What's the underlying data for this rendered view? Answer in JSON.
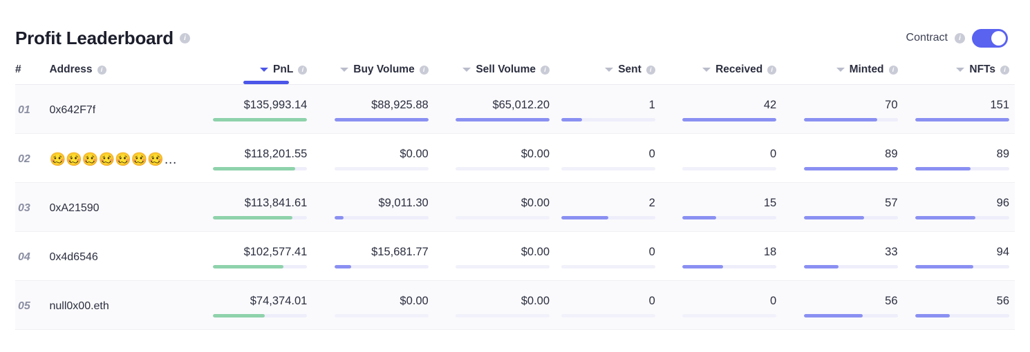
{
  "header": {
    "title": "Profit Leaderboard",
    "title_info_icon": "info-icon",
    "contract_label": "Contract",
    "contract_info_icon": "info-icon",
    "contract_toggle_state": "on"
  },
  "colors": {
    "accent": "#4c56e8",
    "toggle_on": "#5a62f0",
    "bar_purple": "#8a90f2",
    "bar_green": "#8ed2ab",
    "bar_track": "#eeeefb",
    "row_odd_bg": "#fafafc",
    "text": "#2b2e3f",
    "rank_text": "#8b8fa3"
  },
  "table": {
    "columns": [
      {
        "key": "rank",
        "label": "#",
        "align": "left",
        "sortable": false,
        "info": false,
        "sorted": false
      },
      {
        "key": "address",
        "label": "Address",
        "align": "left",
        "sortable": false,
        "info": true,
        "sorted": false
      },
      {
        "key": "pnl",
        "label": "PnL",
        "align": "right",
        "sortable": true,
        "info": true,
        "sorted": true
      },
      {
        "key": "buy",
        "label": "Buy Volume",
        "align": "right",
        "sortable": true,
        "info": true,
        "sorted": false
      },
      {
        "key": "sell",
        "label": "Sell Volume",
        "align": "right",
        "sortable": true,
        "info": true,
        "sorted": false
      },
      {
        "key": "sent",
        "label": "Sent",
        "align": "right",
        "sortable": true,
        "info": true,
        "sorted": false
      },
      {
        "key": "received",
        "label": "Received",
        "align": "right",
        "sortable": true,
        "info": true,
        "sorted": false
      },
      {
        "key": "minted",
        "label": "Minted",
        "align": "right",
        "sortable": true,
        "info": true,
        "sorted": false
      },
      {
        "key": "nfts",
        "label": "NFTs",
        "align": "right",
        "sortable": true,
        "info": true,
        "sorted": false
      }
    ],
    "rows": [
      {
        "rank": "01",
        "address": "0x642F7f",
        "address_is_emoji": false,
        "pnl": {
          "value": "$135,993.14",
          "pct": 100
        },
        "buy": {
          "value": "$88,925.88",
          "pct": 100
        },
        "sell": {
          "value": "$65,012.20",
          "pct": 100
        },
        "sent": {
          "value": "1",
          "pct": 22
        },
        "received": {
          "value": "42",
          "pct": 100
        },
        "minted": {
          "value": "70",
          "pct": 78
        },
        "nfts": {
          "value": "151",
          "pct": 100
        }
      },
      {
        "rank": "02",
        "address": "🥴🥴🥴🥴🥴🥴🥴…",
        "address_is_emoji": true,
        "pnl": {
          "value": "$118,201.55",
          "pct": 87
        },
        "buy": {
          "value": "$0.00",
          "pct": 0
        },
        "sell": {
          "value": "$0.00",
          "pct": 0
        },
        "sent": {
          "value": "0",
          "pct": 0
        },
        "received": {
          "value": "0",
          "pct": 0
        },
        "minted": {
          "value": "89",
          "pct": 100
        },
        "nfts": {
          "value": "89",
          "pct": 59
        }
      },
      {
        "rank": "03",
        "address": "0xA21590",
        "address_is_emoji": false,
        "pnl": {
          "value": "$113,841.61",
          "pct": 84
        },
        "buy": {
          "value": "$9,011.30",
          "pct": 10
        },
        "sell": {
          "value": "$0.00",
          "pct": 0
        },
        "sent": {
          "value": "2",
          "pct": 50
        },
        "received": {
          "value": "15",
          "pct": 36
        },
        "minted": {
          "value": "57",
          "pct": 64
        },
        "nfts": {
          "value": "96",
          "pct": 64
        }
      },
      {
        "rank": "04",
        "address": "0x4d6546",
        "address_is_emoji": false,
        "pnl": {
          "value": "$102,577.41",
          "pct": 75
        },
        "buy": {
          "value": "$15,681.77",
          "pct": 18
        },
        "sell": {
          "value": "$0.00",
          "pct": 0
        },
        "sent": {
          "value": "0",
          "pct": 0
        },
        "received": {
          "value": "18",
          "pct": 43
        },
        "minted": {
          "value": "33",
          "pct": 37
        },
        "nfts": {
          "value": "94",
          "pct": 62
        }
      },
      {
        "rank": "05",
        "address": "null0x00.eth",
        "address_is_emoji": false,
        "pnl": {
          "value": "$74,374.01",
          "pct": 55
        },
        "buy": {
          "value": "$0.00",
          "pct": 0
        },
        "sell": {
          "value": "$0.00",
          "pct": 0
        },
        "sent": {
          "value": "0",
          "pct": 0
        },
        "received": {
          "value": "0",
          "pct": 0
        },
        "minted": {
          "value": "56",
          "pct": 63
        },
        "nfts": {
          "value": "56",
          "pct": 37
        }
      }
    ]
  }
}
